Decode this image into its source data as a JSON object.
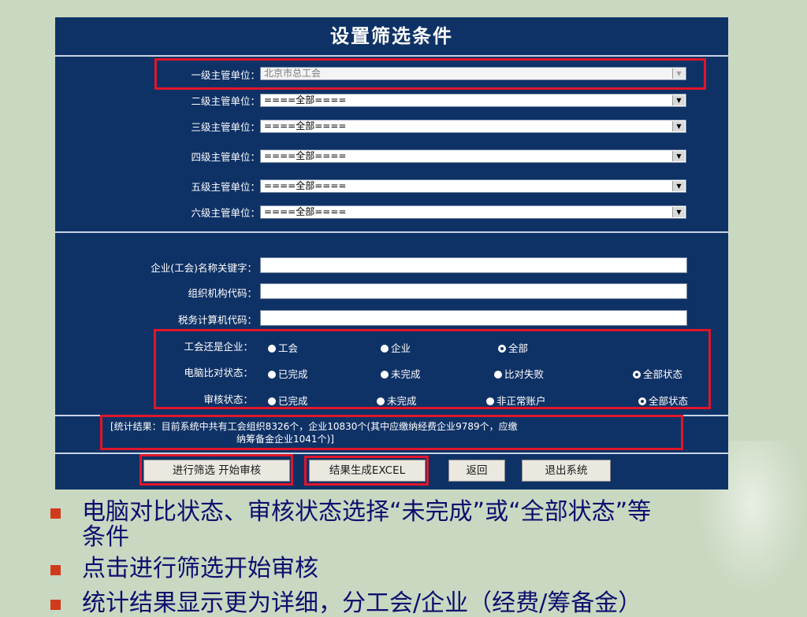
{
  "panel": {
    "title": "设置筛选条件",
    "level_filters": [
      {
        "label": "一级主管单位：",
        "value": "北京市总工会"
      },
      {
        "label": "二级主管单位：",
        "value": "====全部===="
      },
      {
        "label": "三级主管单位：",
        "value": "====全部===="
      },
      {
        "label": "四级主管单位：",
        "value": "====全部===="
      },
      {
        "label": "五级主管单位：",
        "value": "====全部===="
      },
      {
        "label": "六级主管单位：",
        "value": "====全部===="
      }
    ],
    "text_fields": [
      {
        "label": "企业(工会)名称关键字：",
        "value": ""
      },
      {
        "label": "组织机构代码：",
        "value": ""
      },
      {
        "label": "税务计算机代码：",
        "value": ""
      }
    ],
    "radio_groups": [
      {
        "label": "工会还是企业：",
        "options": [
          "工会",
          "企业",
          "全部"
        ],
        "selected": 2
      },
      {
        "label": "电脑比对状态：",
        "options": [
          "已完成",
          "未完成",
          "比对失败",
          "全部状态"
        ],
        "selected": 3
      },
      {
        "label": "审核状态：",
        "options": [
          "已完成",
          "未完成",
          "非正常账户",
          "全部状态"
        ],
        "selected": 3
      }
    ],
    "stats_line1": "[统计结果：目前系统中共有工会组织8326个，企业10830个(其中应缴纳经费企业9789个，应缴",
    "stats_line2": "纳筹备金企业1041个)]",
    "buttons": {
      "filter": "进行筛选 开始审核",
      "excel": "结果生成EXCEL",
      "back": "返回",
      "exit": "退出系统"
    }
  },
  "bullets": [
    "电脑对比状态、审核状态选择“未完成”或“全部状态”等",
    "条件",
    "点击进行筛选开始审核",
    "统计结果显示更为详细，分工会/企业（经费/筹备金）"
  ],
  "colors": {
    "panel_bg": "#0f3266",
    "highlight": "#e0162b",
    "bullet_text": "#0e0e6e",
    "bullet_marker": "#cf3b1c",
    "slide_bg": "#c9d8c1"
  }
}
